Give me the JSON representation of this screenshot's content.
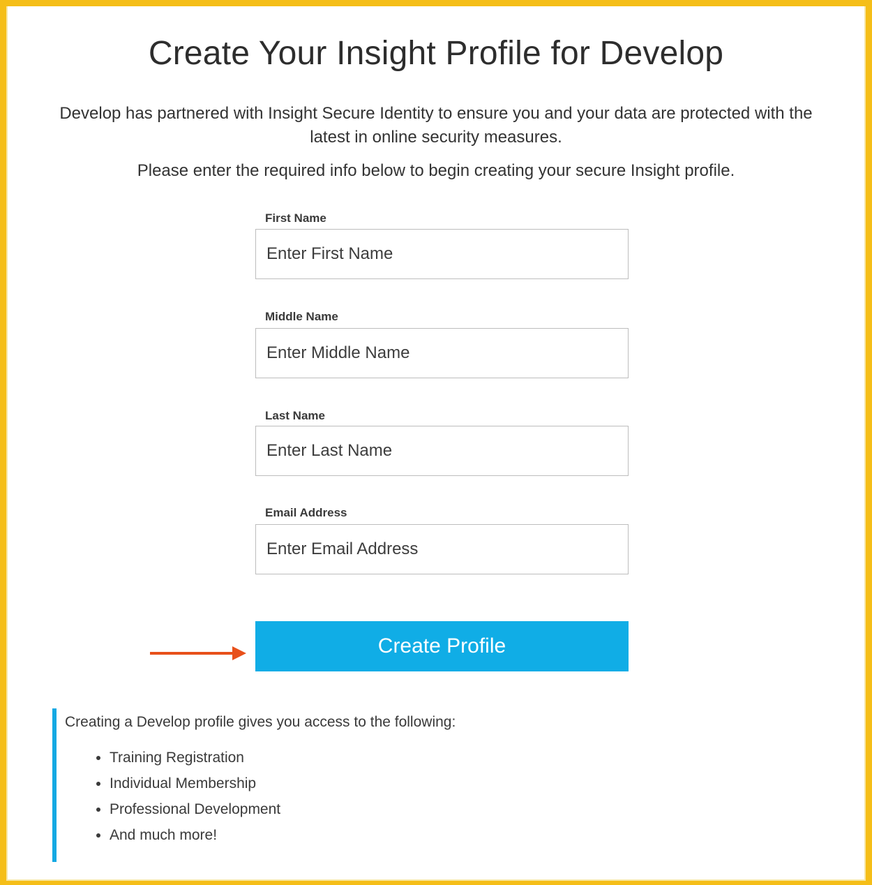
{
  "title": "Create Your Insight Profile for Develop",
  "intro": "Develop has partnered with Insight Secure Identity to ensure you and your data are protected with the latest in online security measures.",
  "instruction": "Please enter the required info below to begin creating your secure Insight profile.",
  "form": {
    "first_name": {
      "label": "First Name",
      "placeholder": "Enter First Name",
      "value": ""
    },
    "middle_name": {
      "label": "Middle Name",
      "placeholder": "Enter Middle Name",
      "value": ""
    },
    "last_name": {
      "label": "Last Name",
      "placeholder": "Enter Last Name",
      "value": ""
    },
    "email": {
      "label": "Email Address",
      "placeholder": "Enter Email Address",
      "value": ""
    },
    "submit_label": "Create Profile"
  },
  "benefits": {
    "intro": "Creating a Develop profile gives you access to the following:",
    "items": [
      "Training Registration",
      "Individual Membership",
      "Professional Development",
      "And much more!"
    ]
  },
  "colors": {
    "frame_border": "#f5be18",
    "button": "#10ade6",
    "arrow": "#e8501a",
    "benefits_bar": "#14a9e3"
  },
  "icons": {
    "pointer": "arrow-right-icon"
  }
}
